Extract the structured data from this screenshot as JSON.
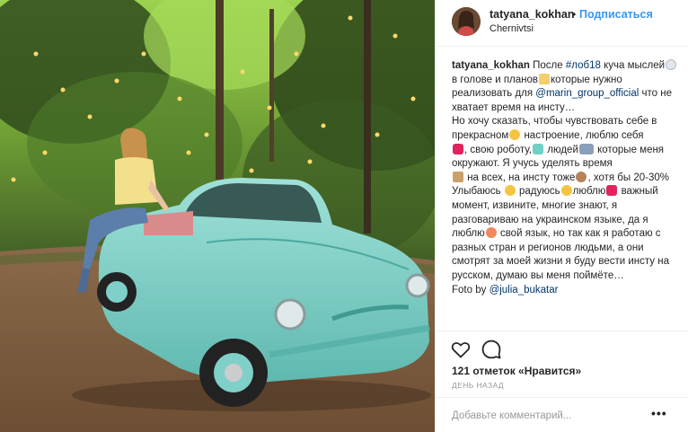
{
  "post": {
    "username": "tatyana_kokhan",
    "separator": "•",
    "follow_label": "Подписаться",
    "location": "Chernivtsi"
  },
  "caption": {
    "username": "tatyana_kokhan",
    "t1": " После ",
    "hashtag": "#лоб18",
    "t2": " куча мыслей",
    "t3": " в голове и планов",
    "t4": "которые нужно реализовать для ",
    "mention1": "@marin_group_official",
    "t5": " что не хватает время на инсту…",
    "t6": "Но хочу сказать, чтобы чувствовать себе в прекрасном",
    "t7": " настроение, люблю себя",
    "t8": ", свою роботу,",
    "t9": " людей",
    "t10": " которые меня окружают. Я учусь уделять время",
    "t11": " на всех, на инсту тоже",
    "t12": ", хотя бы 20-30%",
    "t13": "Улыбаюсь ",
    "t14": " радуюсь",
    "t15": "люблю",
    "t16": " важный момент, извините, многие знают, я разговариваю на украинском языке, да я люблю",
    "t17": " свой язык, но так как я работаю с разных стран и регионов людьми, а они смотрят за моей жизни я буду вести инсту на русском, думаю вы меня поймёте…",
    "t18": "Foto by ",
    "mention2": "@julia_bukatar"
  },
  "actions": {
    "like_icon": "heart-icon",
    "comment_icon": "comment-icon",
    "likes_text": "121 отметок «Нравится»",
    "age_text": "ДЕНЬ НАЗАД"
  },
  "comment": {
    "placeholder": "Добавьте комментарий...",
    "more_label": "•••"
  },
  "colors": {
    "link": "#3897f0",
    "hashtag": "#003569",
    "car": "#7fd0c8"
  }
}
